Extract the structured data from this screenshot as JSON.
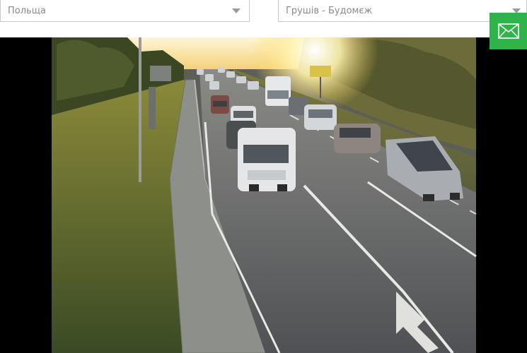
{
  "filters": {
    "country": {
      "value": "Польща"
    },
    "checkpoint": {
      "value": "Грушів - Будомєж"
    }
  },
  "camera": {
    "feed": "border-checkpoint-camera"
  },
  "actions": {
    "mail_icon": "envelope-icon"
  },
  "colors": {
    "mail_button": "#2fb34a",
    "select_border": "#c9c9c9",
    "select_text": "#8a8a8a"
  }
}
